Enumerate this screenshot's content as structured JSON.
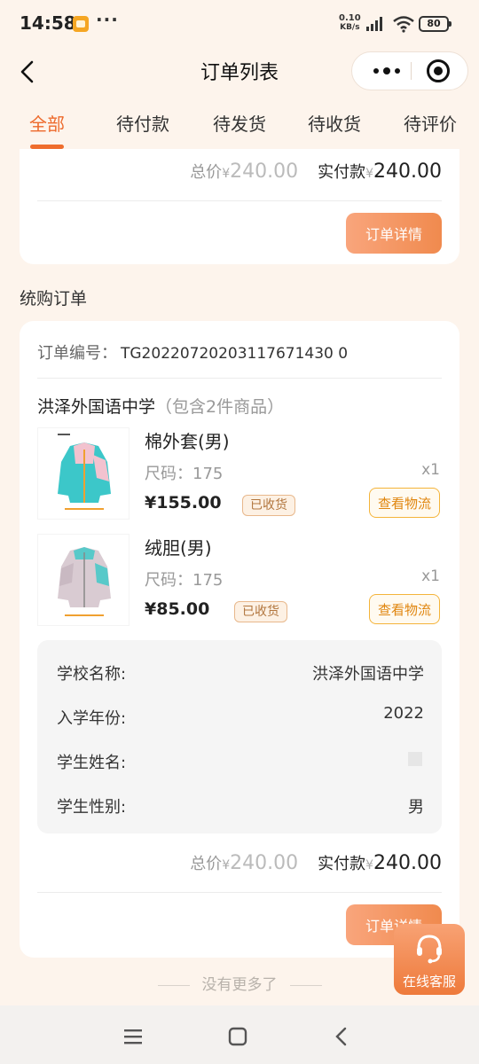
{
  "status_bar": {
    "time": "14:58",
    "more": "···",
    "speed_value": "0.10",
    "speed_unit": "KB/s",
    "battery": "80",
    "icons": [
      "notes-app-icon",
      "signal-icon",
      "wifi-icon",
      "battery-icon"
    ]
  },
  "nav": {
    "title": "订单列表",
    "icons": [
      "back-arrow-icon",
      "more-dots-icon",
      "close-target-icon"
    ]
  },
  "tabs": [
    {
      "label": "全部",
      "active": true
    },
    {
      "label": "待付款",
      "active": false
    },
    {
      "label": "待发货",
      "active": false
    },
    {
      "label": "待收货",
      "active": false
    },
    {
      "label": "待评价",
      "active": false
    }
  ],
  "prev_order": {
    "total_label": "总价",
    "currency": "¥",
    "total_amount": "240.00",
    "paid_label": "实付款",
    "paid_amount": "240.00",
    "detail_button": "订单详情"
  },
  "section_heading": "统购订单",
  "order": {
    "order_no_label": "订单编号：",
    "order_no": "TG20220720203117671430 0",
    "shop": "洪泽外国语中学",
    "shop_note": "（包含2件商品）",
    "products": [
      {
        "name": "棉外套(男)",
        "size_label": "尺码：",
        "size": "175",
        "qty": "x1",
        "price": "¥155.00",
        "status": "已收货",
        "logistics_button": "查看物流",
        "colors": {
          "body": "#3cc7c9",
          "accent": "#f2c2cf"
        }
      },
      {
        "name": "绒胆(男)",
        "size_label": "尺码：",
        "size": "175",
        "qty": "x1",
        "price": "¥85.00",
        "status": "已收货",
        "logistics_button": "查看物流",
        "colors": {
          "body": "#d9cbd2",
          "accent": "#58c9c9"
        }
      }
    ],
    "info": [
      {
        "label": "学校名称:",
        "value": "洪泽外国语中学"
      },
      {
        "label": "入学年份:",
        "value": "2022"
      },
      {
        "label": "学生姓名:",
        "value": ""
      },
      {
        "label": "学生性别:",
        "value": "男"
      }
    ],
    "total_label": "总价",
    "currency": "¥",
    "total_amount": "240.00",
    "paid_label": "实付款",
    "paid_amount": "240.00",
    "detail_button": "订单详情"
  },
  "no_more_text": "没有更多了",
  "service_button": "在线客服",
  "system_nav": {
    "icons": [
      "menu-icon",
      "home-icon",
      "back-icon"
    ]
  },
  "colors": {
    "accent": "#ed6a2c",
    "background": "#fdf4ec",
    "button_gradient_start": "#f9a57c",
    "button_gradient_end": "#f08a4e",
    "logistics": "#e0860f"
  }
}
